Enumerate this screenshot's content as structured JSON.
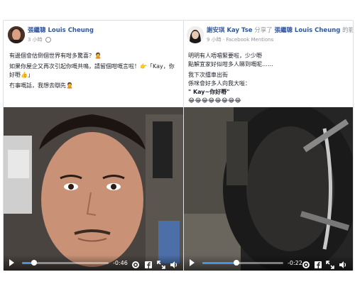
{
  "left_post": {
    "author": "張繼聰 Louis Cheung",
    "time": "3 小時",
    "lines": [
      "有邊個會估倒個世界有咁多驚喜？🙎",
      "如果你屋企又再次引起你嘅共鳴，請留個咁嘅言啦！👉「Kay，你好嘢👍」",
      "冇事嘅話，我想去瞓先🙎"
    ],
    "video": {
      "time_remaining": "-0:46",
      "progress": 0.14,
      "icons": [
        "play-icon",
        "gear-icon",
        "facebook-icon",
        "expand-icon",
        "volume-icon"
      ]
    }
  },
  "right_post": {
    "author": "謝安琪 Kay Tse",
    "shared_text": "分享了",
    "shared_author": "張繼聰 Louis Cheung",
    "shared_suffix": "的影片。",
    "time": "9 小時 · Facebook Mentions",
    "lines": [
      "明明有人唔唱緊要啦，少少嘢",
      "點解宜家好似咁多人睇到嘅呢……",
      "我下次擂車出街",
      "係咪會好多人向我大嗌：",
      "\" Kay~你好嘢\"",
      "😂😂😂😂😂😂😂😂"
    ],
    "video": {
      "time_remaining": "-0:22",
      "progress": 0.42,
      "icons": [
        "play-icon",
        "gear-icon",
        "facebook-icon",
        "expand-icon",
        "volume-icon"
      ]
    }
  }
}
